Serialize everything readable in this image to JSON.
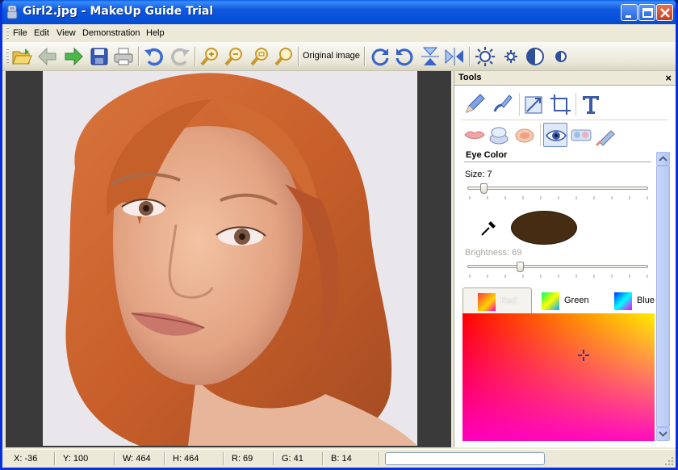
{
  "window": {
    "title": "Girl2.jpg - MakeUp Guide Trial"
  },
  "menu": {
    "items": [
      "File",
      "Edit",
      "View",
      "Demonstration",
      "Help"
    ]
  },
  "toolbar": {
    "original_image_label": "Original image",
    "icons": [
      "open-icon",
      "back-icon",
      "forward-icon",
      "save-icon",
      "print-icon",
      "undo-icon",
      "redo-icon",
      "zoom-in-icon",
      "zoom-out-icon",
      "zoom-fit-icon",
      "zoom-actual-icon",
      "rotate-cw-icon",
      "rotate-ccw-icon",
      "flip-vertical-icon",
      "flip-horizontal-icon",
      "brightness-icon",
      "brightness-small-icon",
      "contrast-icon",
      "contrast-small-icon"
    ]
  },
  "tools": {
    "title": "Tools",
    "close": "×",
    "section_title": "Eye Color",
    "size_label": "Size: 7",
    "size_value": 7,
    "brightness_label": "Brightness: 69",
    "brightness_value": 69,
    "selected_color": "#452c12",
    "tabs": [
      "Red",
      "Green",
      "Blue"
    ],
    "active_tab": "Red"
  },
  "status": {
    "x": "X: -36",
    "y": "Y: 100",
    "w": "W: 464",
    "h": "H: 464",
    "r": "R: 69",
    "g": "G: 41",
    "b": "B: 14"
  }
}
